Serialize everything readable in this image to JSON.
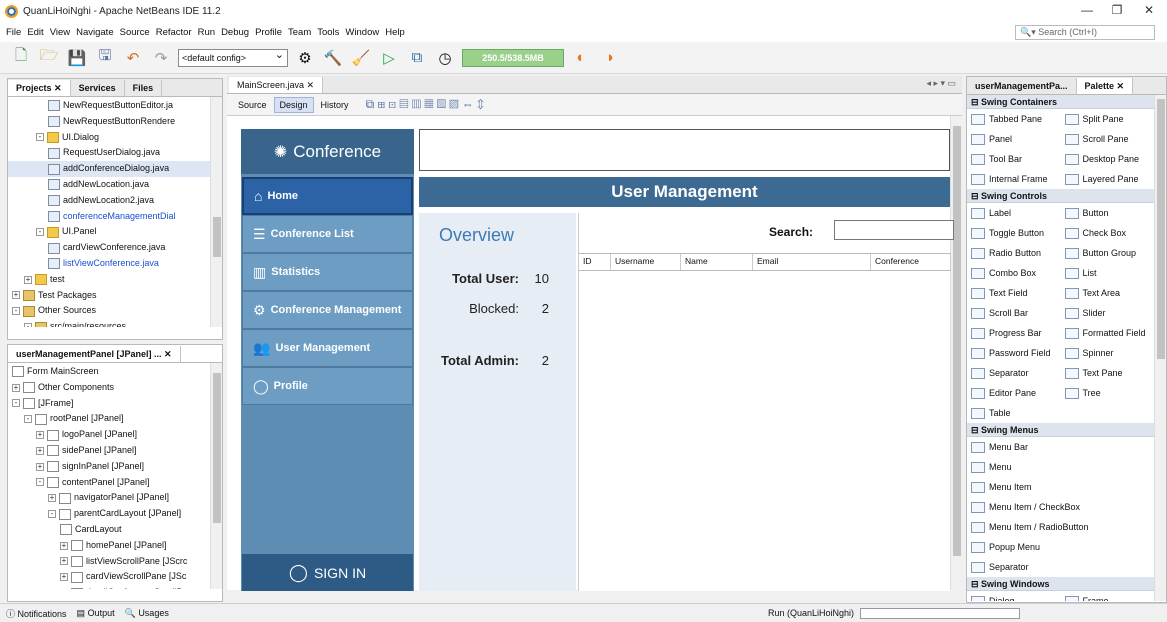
{
  "window": {
    "title": "QuanLiHoiNghi - Apache NetBeans IDE 11.2"
  },
  "menu": [
    "File",
    "Edit",
    "View",
    "Navigate",
    "Source",
    "Refactor",
    "Run",
    "Debug",
    "Profile",
    "Team",
    "Tools",
    "Window",
    "Help"
  ],
  "search": {
    "placeholder": "Search (Ctrl+I)"
  },
  "toolbar": {
    "config": "<default config>",
    "memory": "250.5/538.5MB"
  },
  "projects": {
    "tabs": [
      "Projects",
      "Services",
      "Files"
    ],
    "tree": [
      {
        "label": "NewRequestButtonEditor.ja",
        "depth": 3,
        "icon": "java"
      },
      {
        "label": "NewRequestButtonRendere",
        "depth": 3,
        "icon": "java"
      },
      {
        "label": "UI.Dialog",
        "depth": 2,
        "icon": "pkg",
        "exp": "-"
      },
      {
        "label": "RequestUserDialog.java",
        "depth": 3,
        "icon": "java"
      },
      {
        "label": "addConferenceDialog.java",
        "depth": 3,
        "icon": "java",
        "sel": true
      },
      {
        "label": "addNewLocation.java",
        "depth": 3,
        "icon": "java"
      },
      {
        "label": "addNewLocation2.java",
        "depth": 3,
        "icon": "java"
      },
      {
        "label": "conferenceManagementDial",
        "depth": 3,
        "icon": "java",
        "blue": true
      },
      {
        "label": "UI.Panel",
        "depth": 2,
        "icon": "pkg",
        "exp": "-"
      },
      {
        "label": "cardViewConference.java",
        "depth": 3,
        "icon": "java"
      },
      {
        "label": "listViewConference.java",
        "depth": 3,
        "icon": "java",
        "blue": true
      },
      {
        "label": "test",
        "depth": 1,
        "icon": "pkg",
        "exp": "+"
      },
      {
        "label": "Test Packages",
        "depth": 0,
        "icon": "fld",
        "exp": "+"
      },
      {
        "label": "Other Sources",
        "depth": 0,
        "icon": "fld",
        "exp": "-"
      },
      {
        "label": "src/main/resources",
        "depth": 1,
        "icon": "fld",
        "exp": "-"
      }
    ]
  },
  "navigator": {
    "title": "userManagementPanel [JPanel] ...",
    "tree": [
      {
        "label": "Form MainScreen",
        "depth": 0,
        "icon": "frm"
      },
      {
        "label": "Other Components",
        "depth": 0,
        "icon": "frm",
        "exp": "+"
      },
      {
        "label": "[JFrame]",
        "depth": 0,
        "icon": "frm",
        "exp": "-"
      },
      {
        "label": "rootPanel [JPanel]",
        "depth": 1,
        "icon": "frm",
        "exp": "-"
      },
      {
        "label": "logoPanel [JPanel]",
        "depth": 2,
        "icon": "frm",
        "exp": "+"
      },
      {
        "label": "sidePanel [JPanel]",
        "depth": 2,
        "icon": "frm",
        "exp": "+"
      },
      {
        "label": "signInPanel [JPanel]",
        "depth": 2,
        "icon": "frm",
        "exp": "+"
      },
      {
        "label": "contentPanel [JPanel]",
        "depth": 2,
        "icon": "frm",
        "exp": "-"
      },
      {
        "label": "navigatorPanel [JPanel]",
        "depth": 3,
        "icon": "frm",
        "exp": "+"
      },
      {
        "label": "parentCardLayout [JPanel]",
        "depth": 3,
        "icon": "frm",
        "exp": "-"
      },
      {
        "label": "CardLayout",
        "depth": 4,
        "icon": "frm"
      },
      {
        "label": "homePanel [JPanel]",
        "depth": 4,
        "icon": "frm",
        "exp": "+"
      },
      {
        "label": "listViewScrollPane [JScrc",
        "depth": 4,
        "icon": "frm",
        "exp": "+"
      },
      {
        "label": "cardViewScrollPane [JSc",
        "depth": 4,
        "icon": "frm",
        "exp": "+"
      },
      {
        "label": "detailConferenceScrollP.",
        "depth": 4,
        "icon": "frm",
        "exp": "+"
      }
    ]
  },
  "editor": {
    "file_tab": "MainScreen.java",
    "sub_tabs": [
      "Source",
      "Design",
      "History"
    ]
  },
  "app": {
    "logo": "Conference",
    "nav": [
      {
        "label": "Home",
        "icon": "⌂",
        "active": true
      },
      {
        "label": "Conference List",
        "icon": "☰"
      },
      {
        "label": "Statistics",
        "icon": "▥"
      },
      {
        "label": "Conference Management",
        "icon": "⚙"
      },
      {
        "label": "User Management",
        "icon": "👥"
      },
      {
        "label": "Profile",
        "icon": "◯"
      }
    ],
    "signin": "SIGN IN",
    "header": "User Management",
    "overview": "Overview",
    "stats": [
      {
        "label": "Total User:",
        "value": "10"
      },
      {
        "label": "Blocked:",
        "value": "2"
      },
      {
        "label": "Total Admin:",
        "value": "2"
      }
    ],
    "search_label": "Search:",
    "columns": [
      "ID",
      "Username",
      "Name",
      "Email",
      "Conference"
    ]
  },
  "palette": {
    "tabs": [
      "userManagementPa...",
      "Palette"
    ],
    "sections": [
      {
        "title": "Swing Containers",
        "items": [
          "Tabbed Pane",
          "Split Pane",
          "Panel",
          "Scroll Pane",
          "Tool Bar",
          "Desktop Pane",
          "Internal Frame",
          "Layered Pane"
        ]
      },
      {
        "title": "Swing Controls",
        "items": [
          "Label",
          "Button",
          "Toggle Button",
          "Check Box",
          "Radio Button",
          "Button Group",
          "Combo Box",
          "List",
          "Text Field",
          "Text Area",
          "Scroll Bar",
          "Slider",
          "Progress Bar",
          "Formatted Field",
          "Password Field",
          "Spinner",
          "Separator",
          "Text Pane",
          "Editor Pane",
          "Tree",
          "Table"
        ]
      },
      {
        "title": "Swing Menus",
        "items": [
          "Menu Bar",
          "Menu",
          "Menu Item",
          "Menu Item / CheckBox",
          "Menu Item / RadioButton",
          "Popup Menu",
          "Separator"
        ]
      },
      {
        "title": "Swing Windows",
        "items": [
          "Dialog",
          "Frame"
        ]
      }
    ]
  },
  "status": {
    "notifications": "Notifications",
    "output": "Output",
    "usages": "Usages",
    "run": "Run (QuanLiHoiNghi)"
  }
}
